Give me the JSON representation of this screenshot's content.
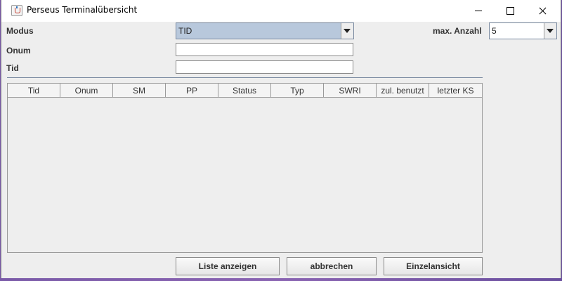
{
  "window": {
    "title": "Perseus Terminalübersicht"
  },
  "form": {
    "modus_label": "Modus",
    "modus_value": "TID",
    "onum_label": "Onum",
    "onum_value": "",
    "tid_label": "Tid",
    "tid_value": "",
    "max_label": "max. Anzahl",
    "max_value": "5"
  },
  "table": {
    "columns": [
      "Tid",
      "Onum",
      "SM",
      "PP",
      "Status",
      "Typ",
      "SWRI",
      "zul. benutzt",
      "letzter KS"
    ],
    "rows": []
  },
  "buttons": {
    "list": "Liste anzeigen",
    "cancel": "abbrechen",
    "single": "Einzelansicht"
  },
  "colors": {
    "combo_selected_bg": "#b8c8dc",
    "window_bg": "#eeeeee",
    "desktop": "#7a5aa8"
  }
}
